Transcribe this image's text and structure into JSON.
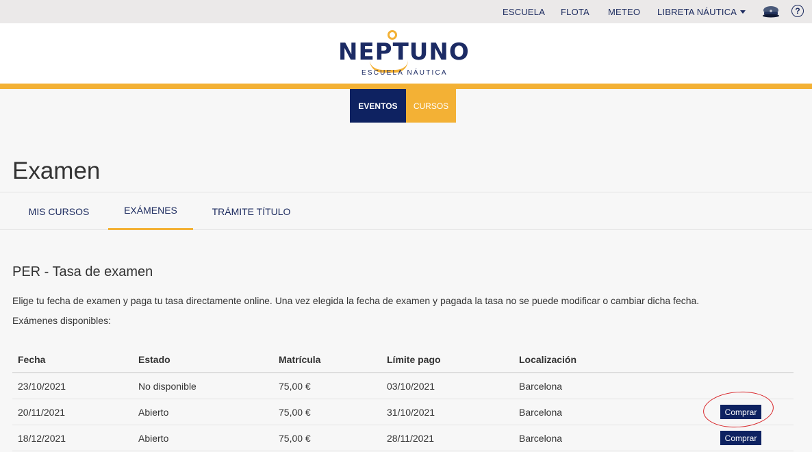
{
  "topnav": {
    "escuela": "ESCUELA",
    "flota": "FLOTA",
    "meteo": "METEO",
    "libreta": "LIBRETA NÁUTICA",
    "help": "?"
  },
  "brand": {
    "logo_text": "NEPTUNO",
    "logo_sub": "ESCUELA NÁUTICA",
    "accent_color": "#f3b135",
    "navy_color": "#0e2261"
  },
  "buttons": {
    "eventos": "EVENTOS",
    "cursos": "CURSOS"
  },
  "page": {
    "title": "Examen"
  },
  "tabs": [
    {
      "label": "MIS CURSOS",
      "active": false
    },
    {
      "label": "EXÁMENES",
      "active": true
    },
    {
      "label": "TRÁMITE TÍTULO",
      "active": false
    }
  ],
  "section": {
    "title": "PER - Tasa de examen",
    "description": "Elige tu fecha de examen y paga tu tasa directamente online. Una vez elegida la fecha de examen y pagada la tasa no se puede modificar o cambiar dicha fecha.",
    "available_label": "Exámenes disponibles:"
  },
  "table": {
    "headers": [
      "Fecha",
      "Estado",
      "Matrícula",
      "Límite pago",
      "Localización"
    ],
    "rows": [
      {
        "fecha": "23/10/2021",
        "estado": "No disponible",
        "matricula": "75,00 €",
        "limite": "03/10/2021",
        "localizacion": "Barcelona",
        "action": ""
      },
      {
        "fecha": "20/11/2021",
        "estado": "Abierto",
        "matricula": "75,00 €",
        "limite": "31/10/2021",
        "localizacion": "Barcelona",
        "action": "Comprar"
      },
      {
        "fecha": "18/12/2021",
        "estado": "Abierto",
        "matricula": "75,00 €",
        "limite": "28/11/2021",
        "localizacion": "Barcelona",
        "action": "Comprar"
      }
    ]
  }
}
